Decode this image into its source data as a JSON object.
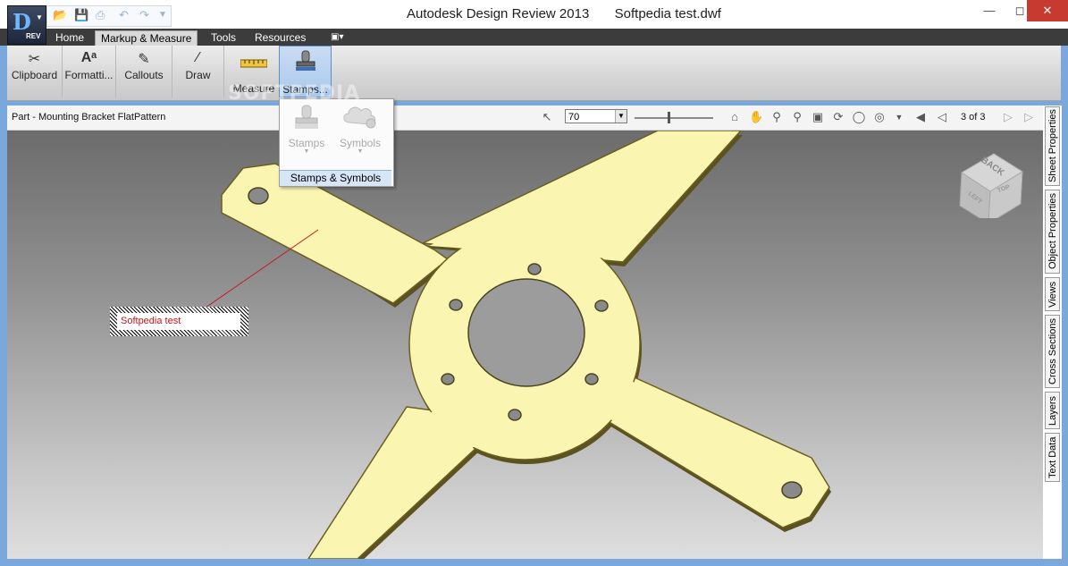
{
  "window": {
    "app_title": "Autodesk Design Review 2013",
    "document_title": "Softpedia test.dwf",
    "app_button_badge": "REV"
  },
  "colors": {
    "title_bar": "#ffffff",
    "tab_bar": "#3c3c3c",
    "part_fill": "#fbf5b2",
    "part_edge": "#6a5f22",
    "markup_red": "#c8161d",
    "active_button": "#aac8ec"
  },
  "quick_access": {
    "icons": [
      "open-icon",
      "save-icon",
      "print-icon",
      "undo-icon",
      "redo-icon",
      "customize-dropdown-icon"
    ]
  },
  "menu": {
    "tabs": [
      {
        "label": "Home",
        "active": false
      },
      {
        "label": "Markup & Measure",
        "active": true
      },
      {
        "label": "Tools",
        "active": false
      },
      {
        "label": "Resources",
        "active": false
      }
    ]
  },
  "ribbon": {
    "buttons": [
      {
        "label": "Clipboard",
        "icon": "scissors-icon"
      },
      {
        "label": "Formatti...",
        "icon": "text-format-icon"
      },
      {
        "label": "Callouts",
        "icon": "callout-icon"
      },
      {
        "label": "Draw",
        "icon": "line-draw-icon"
      },
      {
        "label": "Measure",
        "icon": "ruler-icon"
      },
      {
        "label": "Stamps...",
        "icon": "stamp-icon",
        "pressed": true
      }
    ]
  },
  "dropdown": {
    "items": [
      {
        "label": "Stamps",
        "icon": "stamp-icon"
      },
      {
        "label": "Symbols",
        "icon": "symbol-cloud-icon"
      }
    ],
    "footer": "Stamps & Symbols"
  },
  "viewbar": {
    "title": "Part - Mounting Bracket FlatPattern",
    "zoom_value": "70",
    "slider_level": 0.42,
    "page_info": "3 of 3",
    "tools": [
      "select-icon",
      "home-icon",
      "pan-icon",
      "zoom-icon",
      "zoom-window-icon",
      "fit-icon",
      "orbit-icon",
      "turntable-icon",
      "walk-icon",
      "more-icon",
      "first-page-icon",
      "prev-page-icon",
      "next-page-icon",
      "last-page-icon"
    ]
  },
  "markup": {
    "text": "Softpedia test"
  },
  "viewcube": {
    "face_back": "BACK",
    "face_top": "TOP",
    "face_left": "LEFT"
  },
  "side_panels": [
    "Sheet Properties",
    "Object Properties",
    "Views",
    "Cross Sections",
    "Layers",
    "Text Data"
  ],
  "watermark": "SOFTPEDIA"
}
